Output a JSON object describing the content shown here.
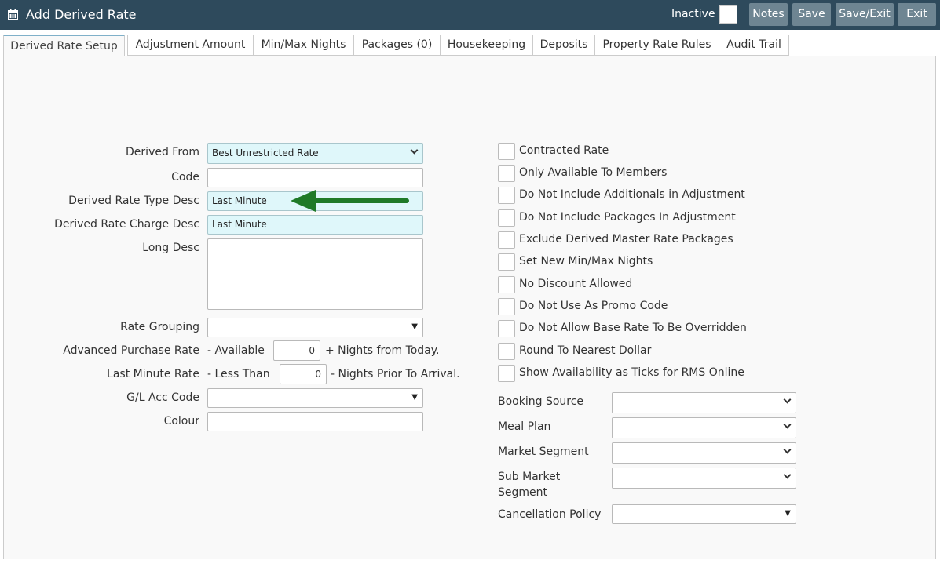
{
  "header": {
    "title": "Add Derived Rate",
    "inactive_label": "Inactive",
    "buttons": {
      "notes": "Notes",
      "save": "Save",
      "save_exit": "Save/Exit",
      "exit": "Exit"
    }
  },
  "tabs": [
    {
      "label": "Derived Rate Setup",
      "active": true
    },
    {
      "label": "Adjustment Amount"
    },
    {
      "label": "Min/Max Nights"
    },
    {
      "label": "Packages (0)"
    },
    {
      "label": "Housekeeping"
    },
    {
      "label": "Deposits"
    },
    {
      "label": "Property Rate Rules"
    },
    {
      "label": "Audit Trail"
    }
  ],
  "form": {
    "derived_from": {
      "label": "Derived From",
      "value": "Best Unrestricted Rate"
    },
    "code": {
      "label": "Code",
      "value": ""
    },
    "type_desc": {
      "label": "Derived Rate Type Desc",
      "value": "Last Minute"
    },
    "charge_desc": {
      "label": "Derived Rate Charge Desc",
      "value": "Last Minute"
    },
    "long_desc": {
      "label": "Long Desc",
      "value": ""
    },
    "rate_grouping": {
      "label": "Rate Grouping",
      "value": ""
    },
    "adv_purchase": {
      "label": "Advanced Purchase Rate",
      "prefix": "- Available",
      "value": "0",
      "suffix": "+ Nights from Today."
    },
    "last_minute": {
      "label": "Last Minute Rate",
      "prefix": "- Less Than",
      "value": "0",
      "suffix": "- Nights Prior To Arrival."
    },
    "gl_acc": {
      "label": "G/L Acc Code",
      "value": ""
    },
    "colour": {
      "label": "Colour",
      "value": ""
    }
  },
  "checkboxes": [
    "Contracted Rate",
    "Only Available To Members",
    "Do Not Include Additionals in Adjustment",
    "Do Not Include Packages In Adjustment",
    "Exclude Derived Master Rate Packages",
    "Set New Min/Max Nights",
    "No Discount Allowed",
    "Do Not Use As Promo Code",
    "Do Not Allow Base Rate To Be Overridden",
    "Round To Nearest Dollar",
    "Show Availability as Ticks for RMS Online"
  ],
  "right_selects": {
    "booking_source": {
      "label": "Booking Source",
      "value": ""
    },
    "meal_plan": {
      "label": "Meal Plan",
      "value": ""
    },
    "market_segment": {
      "label": "Market Segment",
      "value": ""
    },
    "sub_market_line1": "Sub Market",
    "sub_market_line2": "Segment",
    "sub_market": {
      "value": ""
    },
    "cancellation": {
      "label": "Cancellation Policy",
      "value": ""
    }
  },
  "icons": {
    "title": "calendar-icon",
    "arrow": "green-arrow-icon"
  },
  "colors": {
    "header": "#2e4a5c",
    "button": "#6e8592",
    "highlight_field": "#dff7fa",
    "arrow": "#1f7a28"
  }
}
